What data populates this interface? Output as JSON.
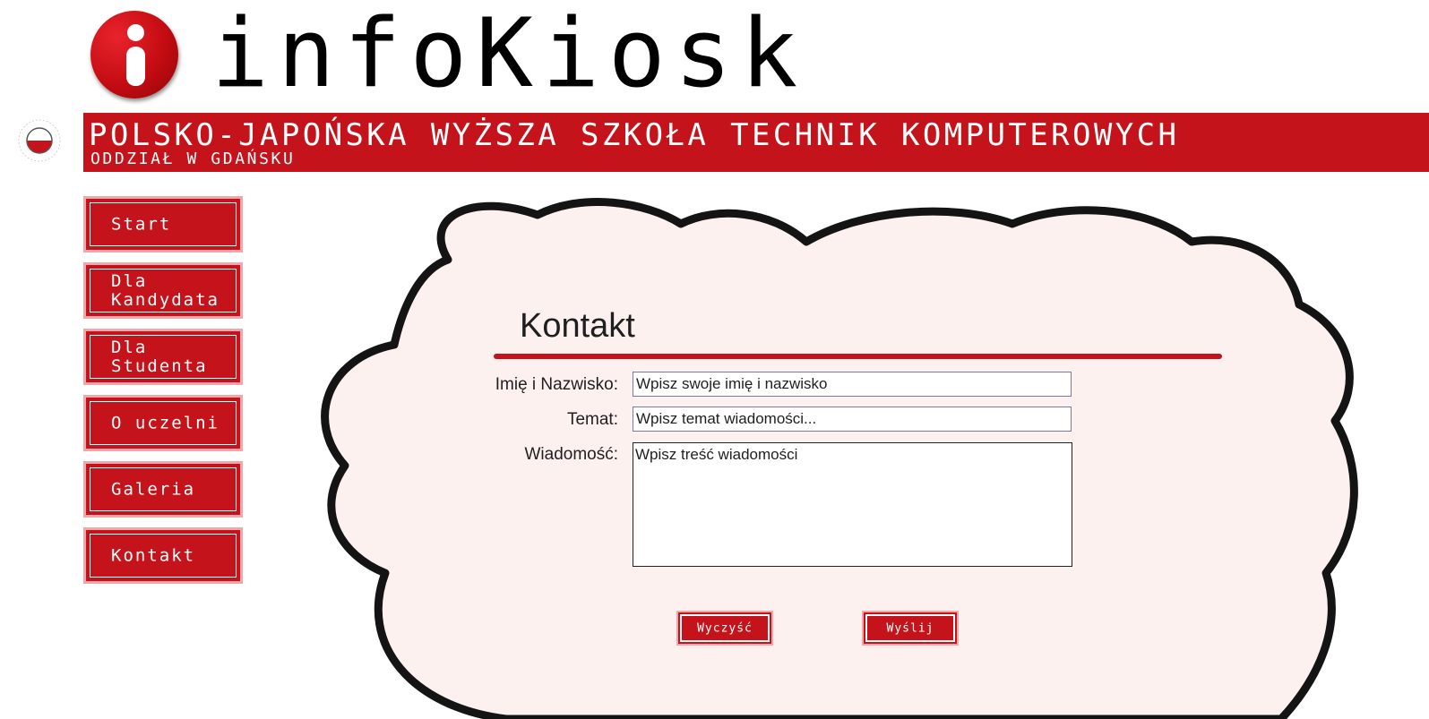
{
  "header": {
    "logo_text": "infoKiosk",
    "school_name": "POLSKO-JAPOŃSKA WYŻSZA SZKOŁA TECHNIK KOMPUTEROWYCH",
    "branch": "ODDZIAŁ W GDAŃSKU"
  },
  "nav": {
    "items": [
      {
        "label": "Start"
      },
      {
        "label": "Dla\nKandydata"
      },
      {
        "label": "Dla\nStudenta"
      },
      {
        "label": "O uczelni"
      },
      {
        "label": "Galeria"
      },
      {
        "label": "Kontakt"
      }
    ]
  },
  "contact": {
    "title": "Kontakt",
    "name_label": "Imię i Nazwisko:",
    "name_value": "Wpisz swoje imię i nazwisko",
    "subject_label": "Temat:",
    "subject_value": "Wpisz temat wiadomości...",
    "message_label": "Wiadomość:",
    "message_value": "Wpisz treść wiadomości",
    "clear_label": "Wyczyść",
    "send_label": "Wyślij"
  },
  "colors": {
    "brand_red": "#c4131a",
    "cloud_fill": "#fdf1f0"
  }
}
